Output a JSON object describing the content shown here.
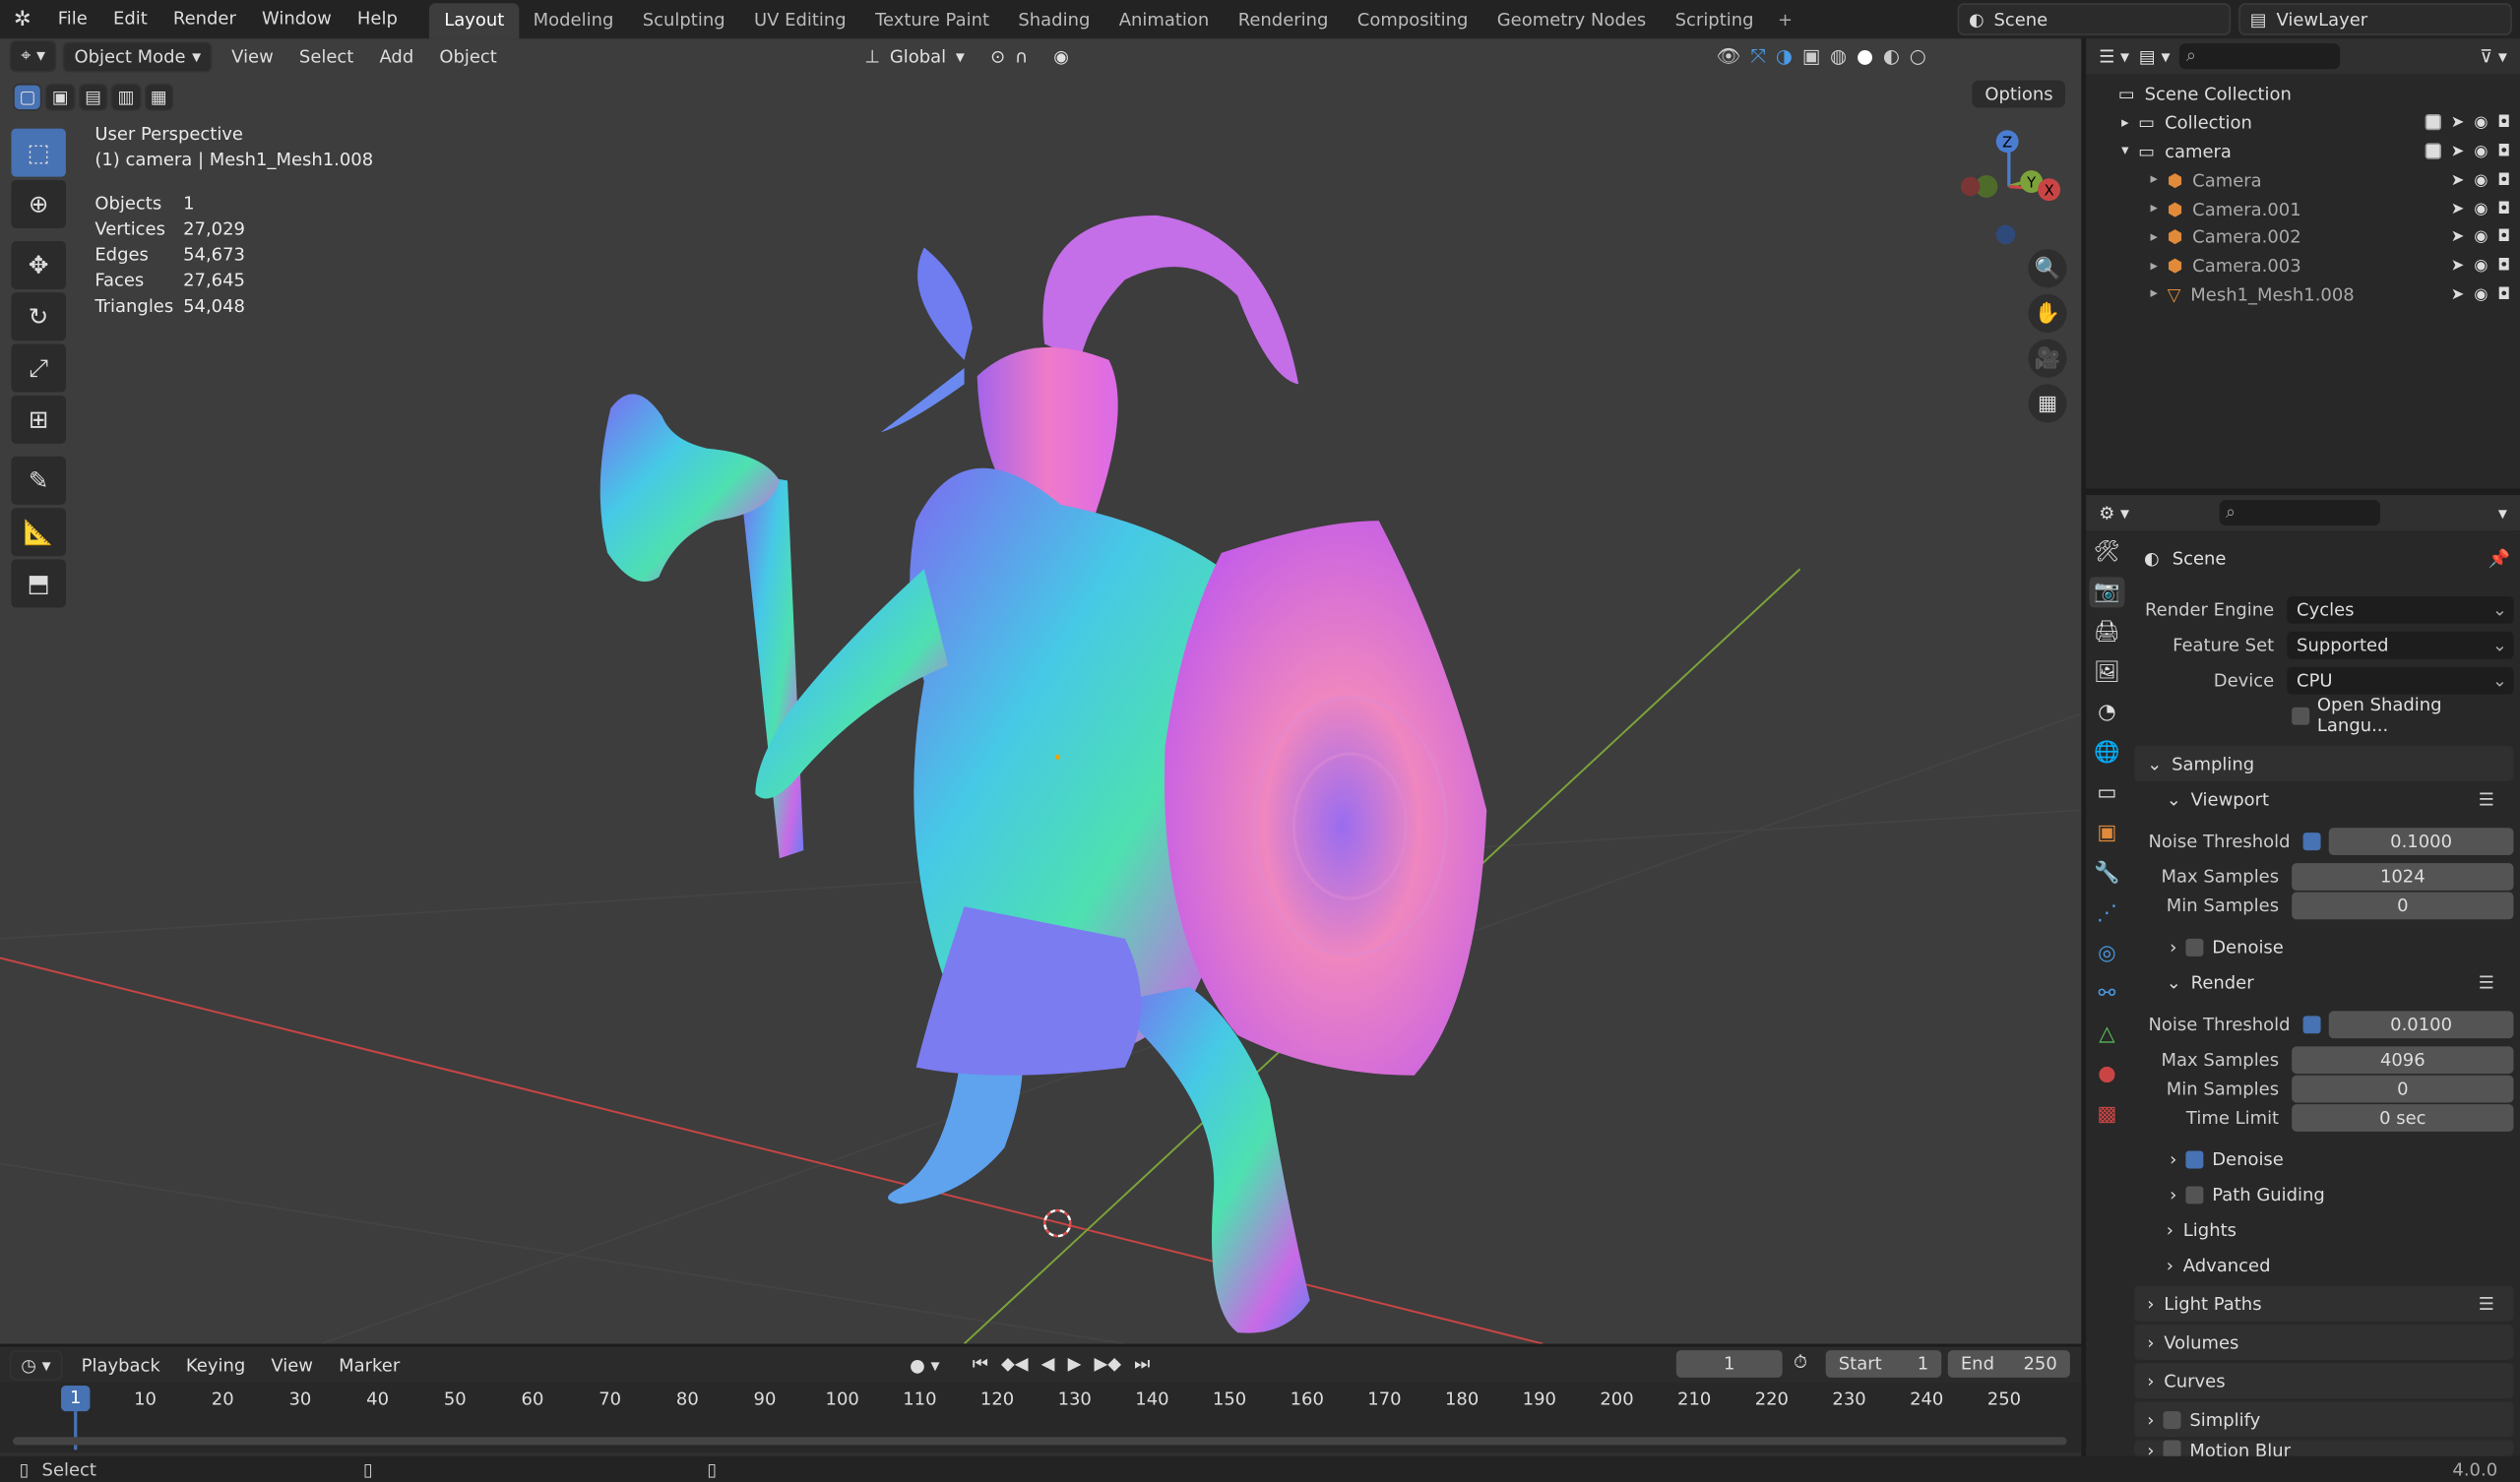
{
  "topbar": {
    "menu": [
      "File",
      "Edit",
      "Render",
      "Window",
      "Help"
    ],
    "workspaces": [
      "Layout",
      "Modeling",
      "Sculpting",
      "UV Editing",
      "Texture Paint",
      "Shading",
      "Animation",
      "Rendering",
      "Compositing",
      "Geometry Nodes",
      "Scripting"
    ],
    "active_workspace": "Layout",
    "scene": "Scene",
    "view_layer": "ViewLayer"
  },
  "viewport": {
    "mode": "Object Mode",
    "menus": [
      "View",
      "Select",
      "Add",
      "Object"
    ],
    "transform_orientation": "Global",
    "options_label": "Options",
    "view_name": "User Perspective",
    "context": "(1) camera | Mesh1_Mesh1.008",
    "stats": [
      {
        "label": "Objects",
        "value": "1"
      },
      {
        "label": "Vertices",
        "value": "27,029"
      },
      {
        "label": "Edges",
        "value": "54,673"
      },
      {
        "label": "Faces",
        "value": "27,645"
      },
      {
        "label": "Triangles",
        "value": "54,048"
      }
    ],
    "gizmo_axes": [
      "Z",
      "Y",
      "X"
    ],
    "colors": {
      "bg": "#3d3d3d",
      "x_axis": "#c94545",
      "y_axis": "#7ba33a",
      "active": "#4772b3"
    }
  },
  "outliner": {
    "root": "Scene Collection",
    "rows": [
      {
        "label": "Collection",
        "indent": 1
      },
      {
        "label": "camera",
        "indent": 1
      },
      {
        "label": "Camera",
        "indent": 2
      },
      {
        "label": "Camera.001",
        "indent": 2
      },
      {
        "label": "Camera.002",
        "indent": 2
      },
      {
        "label": "Camera.003",
        "indent": 2
      },
      {
        "label": "Mesh1_Mesh1.008",
        "indent": 2
      }
    ]
  },
  "properties": {
    "title": "Scene",
    "render_engine_label": "Render Engine",
    "render_engine": "Cycles",
    "feature_set_label": "Feature Set",
    "feature_set": "Supported",
    "device_label": "Device",
    "device": "CPU",
    "osl_label": "Open Shading Langu...",
    "sampling": "Sampling",
    "viewport": "Viewport",
    "render": "Render",
    "noise_threshold_label": "Noise Threshold",
    "max_samples_label": "Max Samples",
    "min_samples_label": "Min Samples",
    "time_limit_label": "Time Limit",
    "vp_noise": "0.1000",
    "vp_max": "1024",
    "vp_min": "0",
    "r_noise": "0.0100",
    "r_max": "4096",
    "r_min": "0",
    "r_time": "0 sec",
    "denoise": "Denoise",
    "path_guiding": "Path Guiding",
    "lights": "Lights",
    "advanced": "Advanced",
    "light_paths": "Light Paths",
    "volumes": "Volumes",
    "curves": "Curves",
    "simplify": "Simplify",
    "motion_blur": "Motion Blur"
  },
  "timeline": {
    "menus": [
      "Playback",
      "Keying",
      "View",
      "Marker"
    ],
    "current_frame": "1",
    "start_label": "Start",
    "start": "1",
    "end_label": "End",
    "end": "250",
    "ticks": [
      "1",
      "10",
      "20",
      "30",
      "40",
      "50",
      "60",
      "70",
      "80",
      "90",
      "100",
      "110",
      "120",
      "130",
      "140",
      "150",
      "160",
      "170",
      "180",
      "190",
      "200",
      "210",
      "220",
      "230",
      "240",
      "250"
    ]
  },
  "statusbar": {
    "left": "Select",
    "version": "4.0.0"
  }
}
